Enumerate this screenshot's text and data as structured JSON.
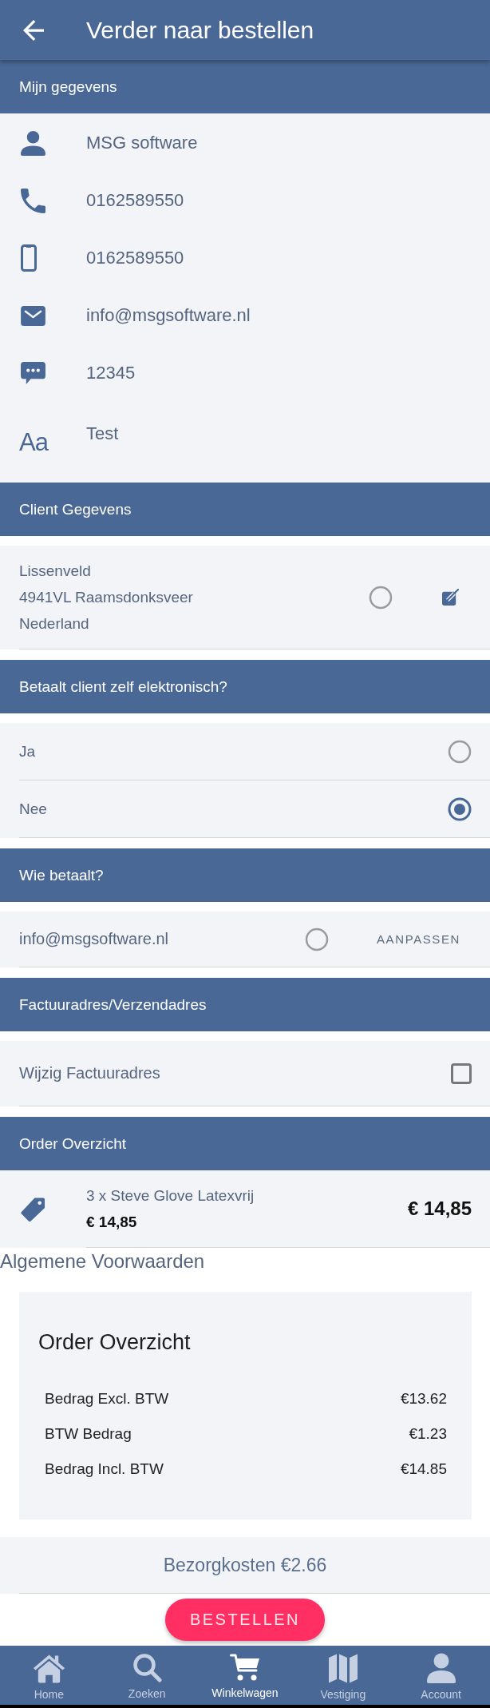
{
  "app_bar": {
    "title": "Verder naar bestellen"
  },
  "sections": [
    {
      "kind": "contact",
      "title": "Mijn gegevens",
      "items": [
        {
          "kind": "person",
          "value": "MSG software"
        },
        {
          "kind": "phone",
          "value": "0162589550"
        },
        {
          "kind": "mobile",
          "value": "0162589550"
        },
        {
          "kind": "email",
          "value": "info@msgsoftware.nl"
        },
        {
          "kind": "message",
          "value": "12345"
        },
        {
          "kind": "text",
          "glyph": "Aa",
          "value": "Test"
        }
      ]
    },
    {
      "kind": "address",
      "title": "Client Gegevens",
      "items": [
        {
          "lines": [
            "Lissenveld",
            "4941VL Raamsdonksveer",
            "Nederland"
          ],
          "selected": false
        }
      ]
    },
    {
      "kind": "options",
      "title": "Betaalt client zelf elektronisch?",
      "items": [
        {
          "label": "Ja",
          "selected": false
        },
        {
          "label": "Nee",
          "selected": true
        }
      ]
    },
    {
      "kind": "payer",
      "title": "Wie betaalt?",
      "items": [
        {
          "label": "info@msgsoftware.nl",
          "selected": false,
          "action": "AANPASSEN"
        }
      ]
    },
    {
      "kind": "checkbox",
      "title": "Factuuradres/Verzendadres",
      "items": [
        {
          "label": "Wijzig Factuuradres",
          "checked": false
        }
      ]
    },
    {
      "kind": "order",
      "title": "Order Overzicht",
      "items": [
        {
          "name": "3 x Steve Glove Latexvrij",
          "unit_price": "€ 14,85",
          "total": "€ 14,85"
        }
      ]
    }
  ],
  "terms": "Algemene Voorwaarden",
  "summary": {
    "title": "Order Overzicht",
    "rows": [
      {
        "label": "Bedrag Excl. BTW",
        "value": "€13.62"
      },
      {
        "label": "BTW Bedrag",
        "value": "€1.23"
      },
      {
        "label": "Bedrag Incl. BTW",
        "value": "€14.85"
      }
    ]
  },
  "delivery": "Bezorgkosten €2.66",
  "order_button": "BESTELLEN",
  "bottom_nav": [
    {
      "kind": "home",
      "label": "Home",
      "selected": false
    },
    {
      "kind": "search",
      "label": "Zoeken",
      "selected": false
    },
    {
      "kind": "cart",
      "label": "Winkelwagen",
      "selected": true
    },
    {
      "kind": "map",
      "label": "Vestiging",
      "selected": false
    },
    {
      "kind": "account",
      "label": "Account",
      "selected": false
    }
  ]
}
